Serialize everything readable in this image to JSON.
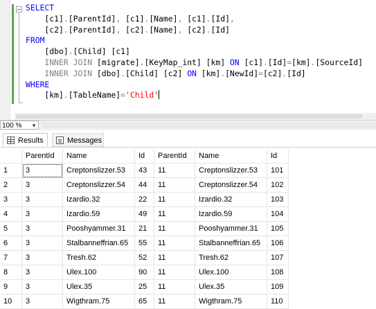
{
  "editor": {
    "lines": [
      [
        {
          "t": "SELECT",
          "c": "kw"
        }
      ],
      [
        {
          "t": "    [c1]",
          "c": ""
        },
        {
          "t": ".",
          "c": "gr"
        },
        {
          "t": "[ParentId]",
          "c": ""
        },
        {
          "t": ", ",
          "c": "gr"
        },
        {
          "t": "[c1]",
          "c": ""
        },
        {
          "t": ".",
          "c": "gr"
        },
        {
          "t": "[Name]",
          "c": ""
        },
        {
          "t": ", ",
          "c": "gr"
        },
        {
          "t": "[c1]",
          "c": ""
        },
        {
          "t": ".",
          "c": "gr"
        },
        {
          "t": "[Id]",
          "c": ""
        },
        {
          "t": ",",
          "c": "gr"
        }
      ],
      [
        {
          "t": "    [c2]",
          "c": ""
        },
        {
          "t": ".",
          "c": "gr"
        },
        {
          "t": "[ParentId]",
          "c": ""
        },
        {
          "t": ", ",
          "c": "gr"
        },
        {
          "t": "[c2]",
          "c": ""
        },
        {
          "t": ".",
          "c": "gr"
        },
        {
          "t": "[Name]",
          "c": ""
        },
        {
          "t": ", ",
          "c": "gr"
        },
        {
          "t": "[c2]",
          "c": ""
        },
        {
          "t": ".",
          "c": "gr"
        },
        {
          "t": "[Id]",
          "c": ""
        }
      ],
      [
        {
          "t": "FROM",
          "c": "kw"
        }
      ],
      [
        {
          "t": "    [dbo]",
          "c": ""
        },
        {
          "t": ".",
          "c": "gr"
        },
        {
          "t": "[Child] [c1]",
          "c": ""
        }
      ],
      [
        {
          "t": "    INNER JOIN ",
          "c": "gr"
        },
        {
          "t": "[migrate]",
          "c": ""
        },
        {
          "t": ".",
          "c": "gr"
        },
        {
          "t": "[KeyMap_int] [km] ",
          "c": ""
        },
        {
          "t": "ON ",
          "c": "kw"
        },
        {
          "t": "[c1]",
          "c": ""
        },
        {
          "t": ".",
          "c": "gr"
        },
        {
          "t": "[Id]",
          "c": ""
        },
        {
          "t": "=",
          "c": "gr"
        },
        {
          "t": "[km]",
          "c": ""
        },
        {
          "t": ".",
          "c": "gr"
        },
        {
          "t": "[SourceId]",
          "c": ""
        }
      ],
      [
        {
          "t": "    INNER JOIN ",
          "c": "gr"
        },
        {
          "t": "[dbo]",
          "c": ""
        },
        {
          "t": ".",
          "c": "gr"
        },
        {
          "t": "[Child] [c2] ",
          "c": ""
        },
        {
          "t": "ON ",
          "c": "kw"
        },
        {
          "t": "[km]",
          "c": ""
        },
        {
          "t": ".",
          "c": "gr"
        },
        {
          "t": "[NewId]",
          "c": ""
        },
        {
          "t": "=",
          "c": "gr"
        },
        {
          "t": "[c2]",
          "c": ""
        },
        {
          "t": ".",
          "c": "gr"
        },
        {
          "t": "[Id]",
          "c": ""
        }
      ],
      [
        {
          "t": "WHERE",
          "c": "kw"
        }
      ],
      [
        {
          "t": "    [km]",
          "c": ""
        },
        {
          "t": ".",
          "c": "gr"
        },
        {
          "t": "[TableName]",
          "c": ""
        },
        {
          "t": "=",
          "c": "gr"
        },
        {
          "t": "'Child'",
          "c": "str"
        }
      ]
    ]
  },
  "zoom": {
    "value": "100 %"
  },
  "tabs": {
    "results": "Results",
    "messages": "Messages"
  },
  "grid": {
    "columns": [
      "ParentId",
      "Name",
      "Id",
      "ParentId",
      "Name",
      "Id"
    ],
    "rows": [
      [
        "1",
        "3",
        "Creptonslizzer.53",
        "43",
        "11",
        "Creptonslizzer.53",
        "101"
      ],
      [
        "2",
        "3",
        "Creptonslizzer.54",
        "44",
        "11",
        "Creptonslizzer.54",
        "102"
      ],
      [
        "3",
        "3",
        "Izardio.32",
        "22",
        "11",
        "Izardio.32",
        "103"
      ],
      [
        "4",
        "3",
        "Izardio.59",
        "49",
        "11",
        "Izardio.59",
        "104"
      ],
      [
        "5",
        "3",
        "Pooshyammer.31",
        "21",
        "11",
        "Pooshyammer.31",
        "105"
      ],
      [
        "6",
        "3",
        "Stalbanneffrian.65",
        "55",
        "11",
        "Stalbanneffrian.65",
        "106"
      ],
      [
        "7",
        "3",
        "Tresh.62",
        "52",
        "11",
        "Tresh.62",
        "107"
      ],
      [
        "8",
        "3",
        "Ulex.100",
        "90",
        "11",
        "Ulex.100",
        "108"
      ],
      [
        "9",
        "3",
        "Ulex.35",
        "25",
        "11",
        "Ulex.35",
        "109"
      ],
      [
        "10",
        "3",
        "Wigthram.75",
        "65",
        "11",
        "Wigthram.75",
        "110"
      ]
    ]
  }
}
